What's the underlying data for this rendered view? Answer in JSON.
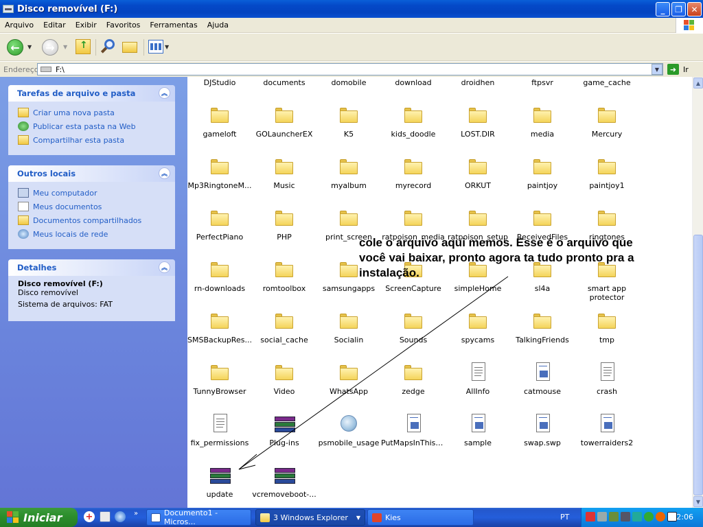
{
  "window": {
    "title": "Disco removível (F:)"
  },
  "menu": [
    "Arquivo",
    "Editar",
    "Exibir",
    "Favoritos",
    "Ferramentas",
    "Ajuda"
  ],
  "address": {
    "label": "Endereço",
    "value": "F:\\",
    "go_label": "Ir"
  },
  "left_pane": {
    "tasks": {
      "title": "Tarefas de arquivo e pasta",
      "items": [
        "Criar uma nova pasta",
        "Publicar esta pasta na Web",
        "Compartilhar esta pasta"
      ]
    },
    "places": {
      "title": "Outros locais",
      "items": [
        "Meu computador",
        "Meus documentos",
        "Documentos compartilhados",
        "Meus locais de rede"
      ]
    },
    "details": {
      "title": "Detalhes",
      "name": "Disco removível (F:)",
      "type": "Disco removível",
      "fs": "Sistema de arquivos: FAT"
    }
  },
  "files": [
    {
      "name": "DJStudio",
      "kind": "folder"
    },
    {
      "name": "documents",
      "kind": "folder"
    },
    {
      "name": "domobile",
      "kind": "folder"
    },
    {
      "name": "download",
      "kind": "folder"
    },
    {
      "name": "droidhen",
      "kind": "folder"
    },
    {
      "name": "ftpsvr",
      "kind": "folder"
    },
    {
      "name": "game_cache",
      "kind": "folder"
    },
    {
      "name": "gameloft",
      "kind": "folder"
    },
    {
      "name": "GOLauncherEX",
      "kind": "folder"
    },
    {
      "name": "K5",
      "kind": "folder"
    },
    {
      "name": "kids_doodle",
      "kind": "folder"
    },
    {
      "name": "LOST.DIR",
      "kind": "folder"
    },
    {
      "name": "media",
      "kind": "folder"
    },
    {
      "name": "Mercury",
      "kind": "folder"
    },
    {
      "name": "Mp3RingtoneM...",
      "kind": "folder"
    },
    {
      "name": "Music",
      "kind": "folder"
    },
    {
      "name": "myalbum",
      "kind": "folder"
    },
    {
      "name": "myrecord",
      "kind": "folder"
    },
    {
      "name": "ORKUT",
      "kind": "folder"
    },
    {
      "name": "paintjoy",
      "kind": "folder"
    },
    {
      "name": "paintjoy1",
      "kind": "folder"
    },
    {
      "name": "PerfectPiano",
      "kind": "folder"
    },
    {
      "name": "PHP",
      "kind": "folder"
    },
    {
      "name": "print_screen",
      "kind": "folder"
    },
    {
      "name": "ratpoison_media",
      "kind": "folder"
    },
    {
      "name": "ratpoison_setup",
      "kind": "folder"
    },
    {
      "name": "ReceivedFiles",
      "kind": "folder"
    },
    {
      "name": "ringtones",
      "kind": "folder"
    },
    {
      "name": "rn-downloads",
      "kind": "folder"
    },
    {
      "name": "romtoolbox",
      "kind": "folder"
    },
    {
      "name": "samsungapps",
      "kind": "folder"
    },
    {
      "name": "ScreenCapture",
      "kind": "folder"
    },
    {
      "name": "simpleHome",
      "kind": "folder"
    },
    {
      "name": "sl4a",
      "kind": "folder"
    },
    {
      "name": "smart app protector",
      "kind": "folder"
    },
    {
      "name": "SMSBackupRes...",
      "kind": "folder"
    },
    {
      "name": "social_cache",
      "kind": "folder"
    },
    {
      "name": "Socialin",
      "kind": "folder"
    },
    {
      "name": "Sounds",
      "kind": "folder"
    },
    {
      "name": "spycams",
      "kind": "folder"
    },
    {
      "name": "TalkingFriends",
      "kind": "folder"
    },
    {
      "name": "tmp",
      "kind": "folder"
    },
    {
      "name": "TunnyBrowser",
      "kind": "folder"
    },
    {
      "name": "Video",
      "kind": "folder"
    },
    {
      "name": "WhatsApp",
      "kind": "folder"
    },
    {
      "name": "zedge",
      "kind": "folder"
    },
    {
      "name": "AllInfo",
      "kind": "text"
    },
    {
      "name": "catmouse",
      "kind": "app"
    },
    {
      "name": "crash",
      "kind": "text"
    },
    {
      "name": "fix_permissions",
      "kind": "text"
    },
    {
      "name": "Plug-ins",
      "kind": "rar"
    },
    {
      "name": "psmobile_usage",
      "kind": "globe"
    },
    {
      "name": "PutMapsInThisF...",
      "kind": "app"
    },
    {
      "name": "sample",
      "kind": "app"
    },
    {
      "name": "swap.swp",
      "kind": "app"
    },
    {
      "name": "towerraiders2",
      "kind": "app"
    },
    {
      "name": "update",
      "kind": "rar"
    },
    {
      "name": "vcremoveboot-...",
      "kind": "rar"
    }
  ],
  "annotation": {
    "text": "cole o  arquivo aqui memos. Esse é o arquivo que você vai baixar, pronto agora ta tudo pronto pra a instalação."
  },
  "taskbar": {
    "start_label": "Iniciar",
    "tasks": [
      {
        "label": "Documento1 - Micros..."
      },
      {
        "label": "3 Windows Explorer"
      },
      {
        "label": "Kies"
      }
    ],
    "language": "PT",
    "clock": "12:06"
  }
}
